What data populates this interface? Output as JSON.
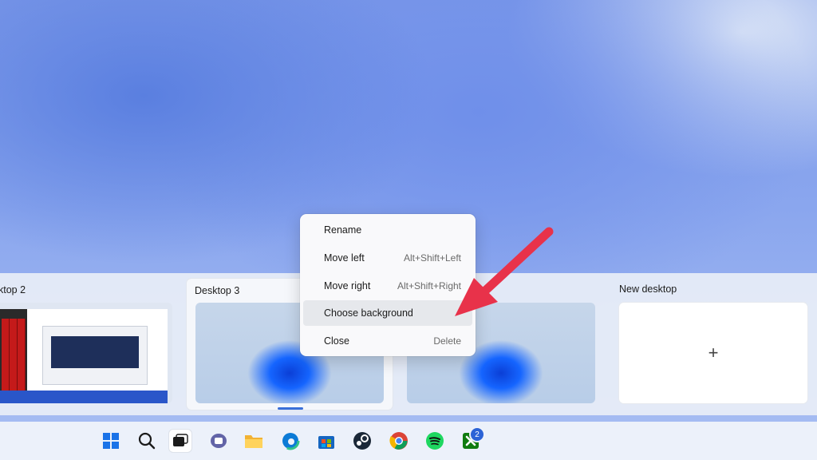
{
  "desktops": [
    {
      "label": "ktop 2"
    },
    {
      "label": "Desktop 3"
    },
    {
      "label": ""
    },
    {
      "label": "New desktop"
    }
  ],
  "new_desktop_symbol": "+",
  "context_menu": {
    "items": [
      {
        "label": "Rename",
        "shortcut": ""
      },
      {
        "label": "Move left",
        "shortcut": "Alt+Shift+Left"
      },
      {
        "label": "Move right",
        "shortcut": "Alt+Shift+Right"
      },
      {
        "label": "Choose background",
        "shortcut": ""
      },
      {
        "label": "Close",
        "shortcut": "Delete"
      }
    ],
    "highlighted": "Choose background"
  },
  "annotation": {
    "arrow_color": "#e8324a"
  },
  "taskbar": {
    "icons": [
      "windows-start-icon",
      "search-icon",
      "task-view-icon",
      "teams-chat-icon",
      "file-explorer-icon",
      "edge-icon",
      "microsoft-store-icon",
      "steam-icon",
      "chrome-icon",
      "spotify-icon",
      "xbox-icon"
    ],
    "xbox_badge": "2"
  },
  "colors": {
    "accent": "#3a6fd8",
    "menu_bg": "#f9f9fb",
    "highlight": "#e6e8ec"
  }
}
